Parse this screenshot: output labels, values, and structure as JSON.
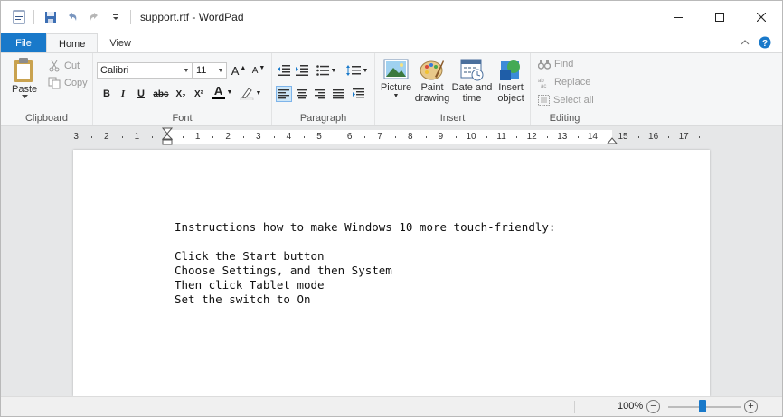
{
  "window": {
    "document_name": "support.rtf",
    "app_name": "WordPad",
    "title_separator": " - "
  },
  "tabs": {
    "file": "File",
    "home": "Home",
    "view": "View"
  },
  "clipboard": {
    "paste": "Paste",
    "cut": "Cut",
    "copy": "Copy",
    "label": "Clipboard"
  },
  "font": {
    "family": "Calibri",
    "size": "11",
    "label": "Font",
    "bold": "B",
    "italic": "I",
    "underline": "U",
    "strikethrough": "abc",
    "subscript": "X₂",
    "superscript": "X²",
    "text_color_glyph": "A",
    "grow": "A",
    "shrink": "A"
  },
  "paragraph": {
    "label": "Paragraph"
  },
  "insert": {
    "picture": "Picture",
    "paint_drawing_line1": "Paint",
    "paint_drawing_line2": "drawing",
    "date_time_line1": "Date and",
    "date_time_line2": "time",
    "insert_object_line1": "Insert",
    "insert_object_line2": "object",
    "label": "Insert"
  },
  "editing": {
    "find": "Find",
    "replace": "Replace",
    "select_all": "Select all",
    "label": "Editing"
  },
  "ruler": {
    "labels": [
      "3",
      "2",
      "1",
      "1",
      "2",
      "3",
      "4",
      "5",
      "6",
      "7",
      "8",
      "9",
      "10",
      "11",
      "12",
      "13",
      "14",
      "15",
      "16",
      "17"
    ]
  },
  "document": {
    "lines": [
      "Instructions how to make Windows 10 more touch-friendly:",
      "",
      "Click the Start button",
      "Choose Settings, and then System",
      "Then click Tablet mode",
      "Set the switch to On"
    ]
  },
  "status": {
    "zoom": "100%",
    "zoom_level": 1.0
  },
  "colors": {
    "accent": "#1979ca",
    "ribbon_bg": "#f5f6f7",
    "doc_bg": "#e6e7e8"
  }
}
